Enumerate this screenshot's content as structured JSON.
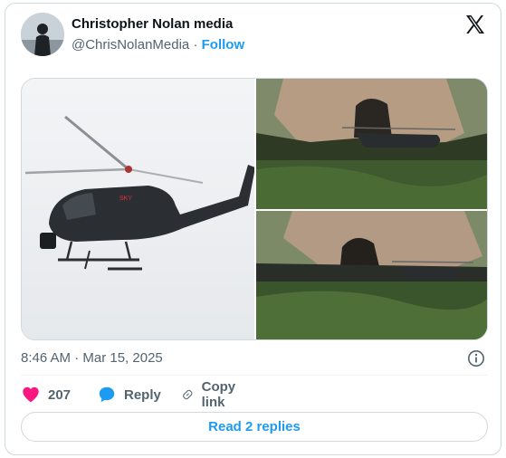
{
  "author": {
    "name": "Christopher Nolan media",
    "handle": "@ChrisNolanMedia",
    "separator": "·",
    "follow_label": "Follow"
  },
  "brand": {
    "logo_icon": "x-logo-icon"
  },
  "media": {
    "images": [
      {
        "label": "SKY"
      }
    ]
  },
  "meta": {
    "timestamp": "8:46 AM · Mar 15, 2025",
    "info_icon": "info-icon"
  },
  "actions": {
    "like_count": "207",
    "reply_label": "Reply",
    "copy_label": "Copy link"
  },
  "footer": {
    "replies_label": "Read 2 replies"
  },
  "colors": {
    "accent": "#1d9bf0",
    "like": "#f91880",
    "muted": "#536471",
    "border": "#cfd9de"
  }
}
